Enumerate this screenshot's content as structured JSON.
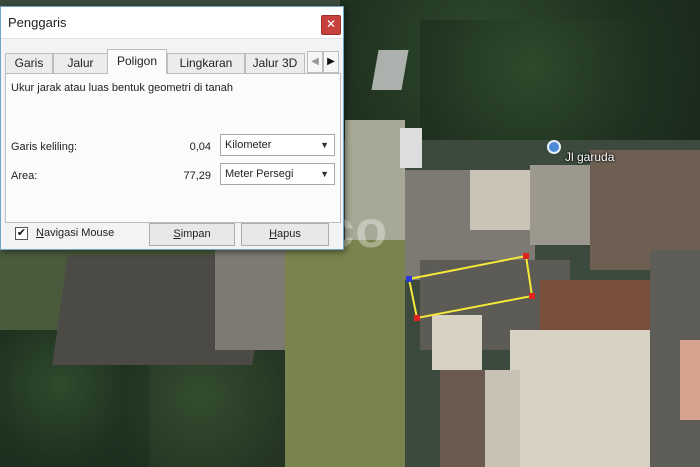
{
  "window": {
    "title": "Penggaris",
    "close_glyph": "✕"
  },
  "tabs": [
    {
      "label": "Garis",
      "active": false
    },
    {
      "label": "Jalur",
      "active": false
    },
    {
      "label": "Poligon",
      "active": true
    },
    {
      "label": "Lingkaran",
      "active": false
    },
    {
      "label": "Jalur 3D",
      "active": false
    }
  ],
  "tab_scroll": {
    "left_icon": "chevron-left-icon",
    "right_icon": "chevron-right-icon",
    "left_glyph": "◀",
    "right_glyph": "▶"
  },
  "panel": {
    "description": "Ukur jarak atau luas bentuk geometri di tanah",
    "perimeter": {
      "label": "Garis keliling:",
      "value": "0,04",
      "unit": "Kilometer"
    },
    "area": {
      "label": "Area:",
      "value": "77,29",
      "unit": "Meter Persegi"
    }
  },
  "footer": {
    "checkbox_checked": true,
    "checkbox_glyph": "✔",
    "mouse_nav_label_prefix": "",
    "mouse_nav_label_u": "N",
    "mouse_nav_label_rest": "avigasi Mouse",
    "save_u": "S",
    "save_rest": "impan",
    "delete_u": "H",
    "delete_rest": "apus"
  },
  "map": {
    "place_label": "Jl garuda",
    "watermark": "99.co",
    "polygon_color": "#f5e83a",
    "vertex_colors": [
      "#2b3bd6",
      "#e0231f"
    ]
  }
}
